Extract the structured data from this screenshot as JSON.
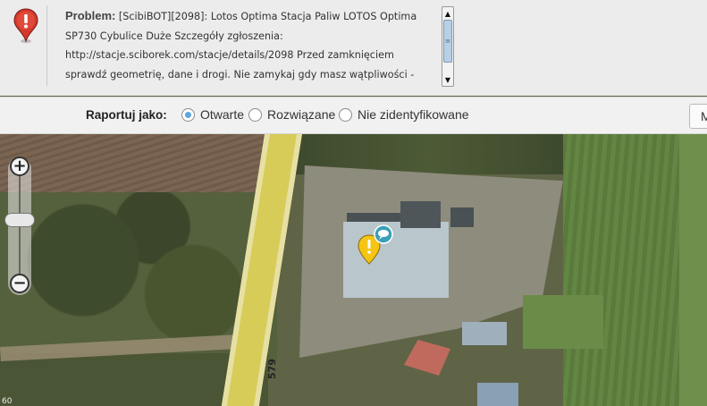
{
  "problem": {
    "label": "Problem:",
    "text": " [ScibiBOT][2098]: Lotos Optima Stacja Paliw LOTOS Optima SP730 Cybulice Duże Szczegóły zgłoszenia: http://stacje.sciborek.com/stacje/details/2098 Przed zamknięciem sprawdź geometrię, dane i drogi. Nie zamykaj gdy masz wątpliwości -"
  },
  "report": {
    "label": "Raportuj jako:",
    "options": [
      {
        "label": "Otwarte",
        "selected": true
      },
      {
        "label": "Rozwiązane",
        "selected": false
      },
      {
        "label": "Nie zidentyfikowane",
        "selected": false
      }
    ],
    "button_label": "M"
  },
  "map": {
    "road_number": "579",
    "scale_label": "60",
    "zoom_in_label": "+",
    "zoom_out_label": "−"
  },
  "colors": {
    "alert_red": "#d33a2c",
    "warning_yellow": "#f4c515",
    "radio_selected": "#5ea6df",
    "road": "#d7cc58"
  },
  "icons": {
    "alert": "alert-circle-icon",
    "warning_pin": "warning-pin-icon",
    "bubble": "comment-bubble-icon"
  }
}
